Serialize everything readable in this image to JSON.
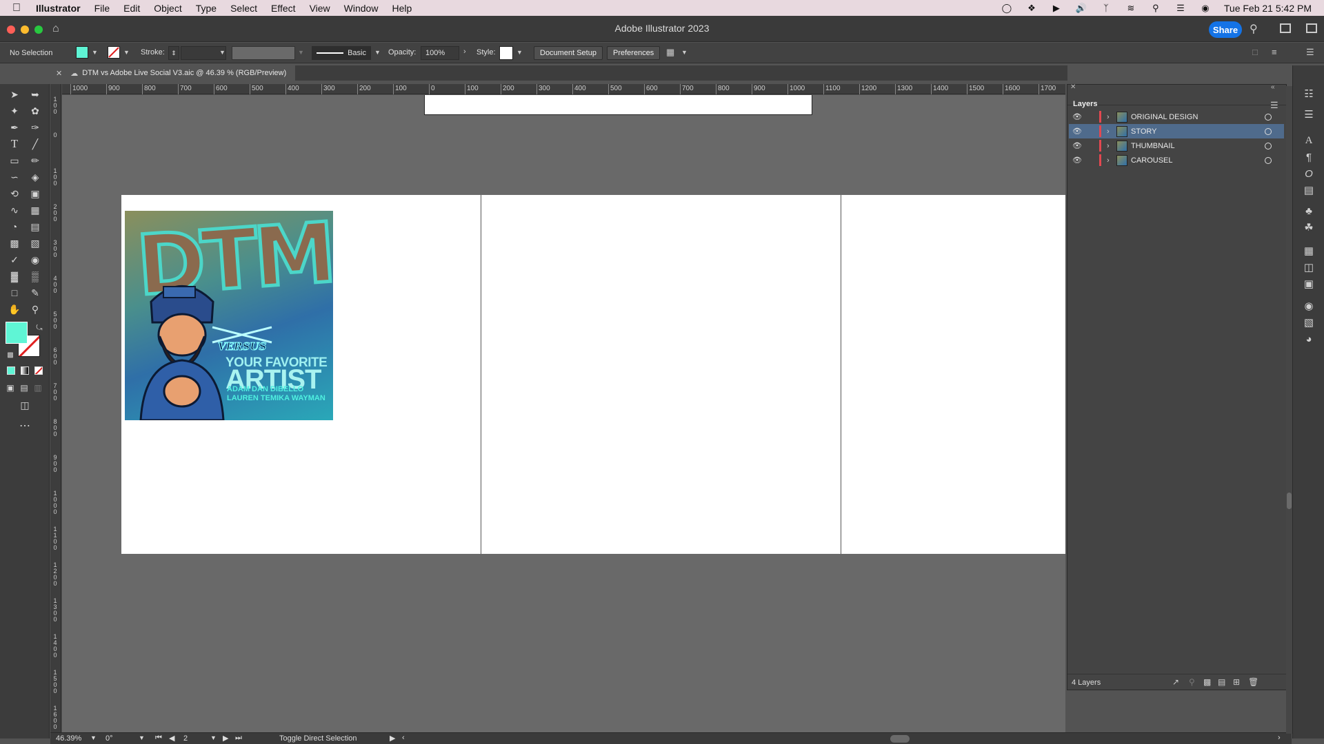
{
  "menubar": {
    "app": "Illustrator",
    "items": [
      "File",
      "Edit",
      "Object",
      "Type",
      "Select",
      "Effect",
      "View",
      "Window",
      "Help"
    ],
    "clock": "Tue Feb 21  5:42 PM"
  },
  "titlebar": {
    "title": "Adobe Illustrator 2023",
    "share": "Share"
  },
  "controlbar": {
    "selection": "No Selection",
    "fill_color": "#5ff5d5",
    "stroke_label": "Stroke:",
    "brush": "Basic",
    "opacity_label": "Opacity:",
    "opacity_value": "100%",
    "style_label": "Style:",
    "document_setup": "Document Setup",
    "preferences": "Preferences"
  },
  "document": {
    "tab_title": "DTM vs Adobe Live Social V3.aic @ 46.39 % (RGB/Preview)"
  },
  "ruler_h": [
    "1000",
    "900",
    "800",
    "700",
    "600",
    "500",
    "400",
    "300",
    "200",
    "100",
    "0",
    "100",
    "200",
    "300",
    "400",
    "500",
    "600",
    "700",
    "800",
    "900",
    "1000",
    "1100",
    "1200",
    "1300",
    "1400",
    "1500",
    "1600",
    "1700"
  ],
  "ruler_v": [
    "1\n0\n0",
    "0",
    "1\n0\n0",
    "2\n0\n0",
    "3\n0\n0",
    "4\n0\n0",
    "5\n0\n0",
    "6\n0\n0",
    "7\n0\n0",
    "8\n0\n0",
    "9\n0\n0",
    "1\n0\n0\n0",
    "1\n1\n0\n0",
    "1\n2\n0\n0",
    "1\n3\n0\n0",
    "1\n4\n0\n0",
    "1\n5\n0\n0",
    "1\n6\n0\n0"
  ],
  "artwork": {
    "title_letters": "DTM",
    "versus": "VERSUS",
    "line1": "YOUR FAVORITE",
    "line2": "ARTIST",
    "line3": "ADAM DAN DIBELLO",
    "line4": "LAUREN TEMIKA WAYMAN"
  },
  "layers": {
    "title": "Layers",
    "items": [
      {
        "name": "ORIGINAL DESIGN",
        "selected": false
      },
      {
        "name": "STORY",
        "selected": true
      },
      {
        "name": "THUMBNAIL",
        "selected": false
      },
      {
        "name": "CAROUSEL",
        "selected": false
      }
    ],
    "count": "4 Layers"
  },
  "statusbar": {
    "zoom": "46.39%",
    "rotation": "0°",
    "artboard": "2",
    "status": "Toggle Direct Selection"
  },
  "colors": {
    "accent": "#1473e6",
    "fill": "#5ff5d5",
    "layer_color": "#e34850",
    "selected_row": "#4f6b8c"
  }
}
